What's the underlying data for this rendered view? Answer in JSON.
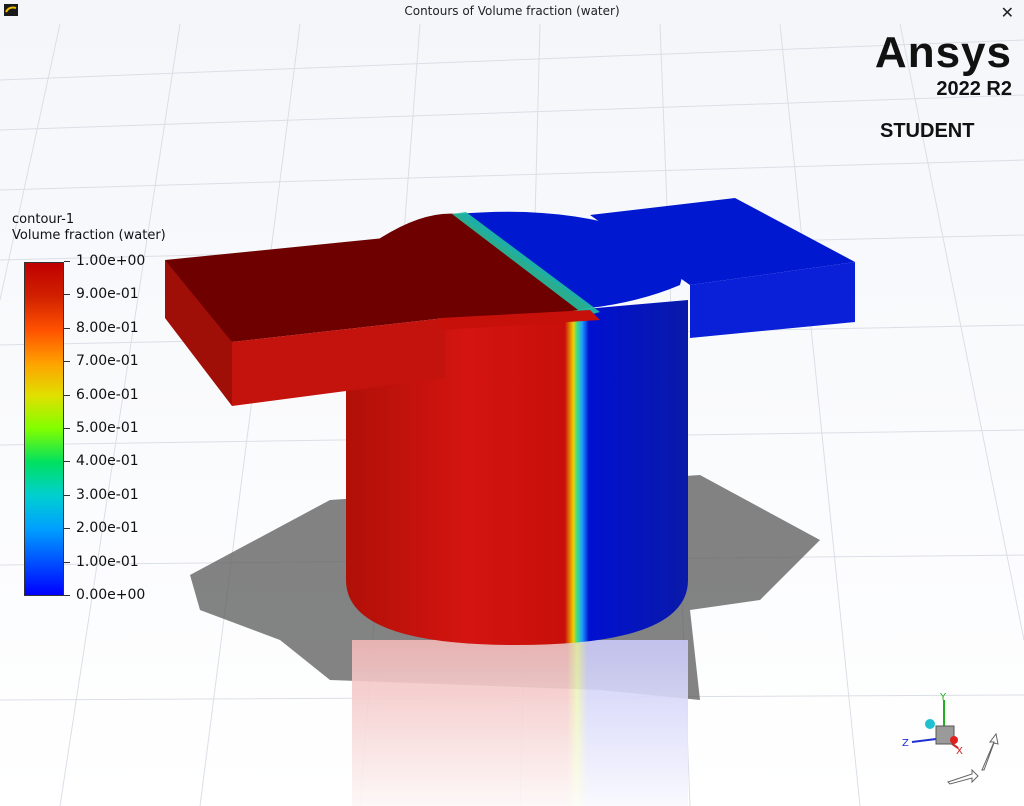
{
  "window": {
    "title": "Contours of Volume fraction (water)",
    "close_glyph": "✕",
    "app_icon": "fluent-app-icon"
  },
  "brand": {
    "name": "Ansys",
    "version": "2022 R2",
    "edition": "STUDENT"
  },
  "legend": {
    "name": "contour-1",
    "quantity": "Volume fraction (water)",
    "ticks": [
      "1.00e+00",
      "9.00e-01",
      "8.00e-01",
      "7.00e-01",
      "6.00e-01",
      "5.00e-01",
      "4.00e-01",
      "3.00e-01",
      "2.00e-01",
      "1.00e-01",
      "0.00e+00"
    ],
    "colormap": [
      "#0000ff",
      "#0050ff",
      "#00a0ff",
      "#00d0d0",
      "#00e060",
      "#80ff00",
      "#e0e000",
      "#ffa000",
      "#ff5000",
      "#d02000",
      "#c00000"
    ]
  },
  "axes_triad": {
    "x_label": "X",
    "y_label": "Y",
    "z_label": "Z"
  },
  "colors": {
    "water": "#c40f0a",
    "air": "#0a14c4",
    "water_top": "#6e0000",
    "air_top": "#0018d0"
  }
}
